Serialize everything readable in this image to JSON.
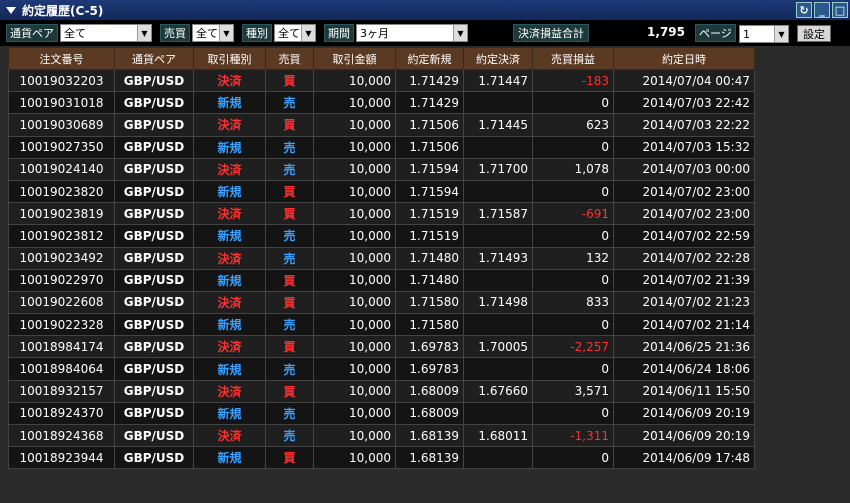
{
  "window": {
    "title": "約定履歴(C-5)",
    "buttons": [
      "refresh-icon",
      "minimize-icon",
      "maximize-icon"
    ]
  },
  "filters": {
    "pair_label": "通貨ペア",
    "pair_value": "全て",
    "side_label": "売買",
    "side_value": "全て",
    "type_label": "種別",
    "type_value": "全て",
    "period_label": "期間",
    "period_value": "3ヶ月",
    "total_label": "決済損益合計",
    "total_value": "1,795",
    "page_label": "ページ",
    "page_value": "1",
    "settings_label": "設定"
  },
  "table": {
    "headers": [
      "注文番号",
      "通貨ペア",
      "取引種別",
      "売買",
      "取引金額",
      "約定新規",
      "約定決済",
      "売買損益",
      "約定日時"
    ],
    "rows": [
      [
        "10019032203",
        "GBP/USD",
        "決済",
        "買",
        "10,000",
        "1.71429",
        "1.71447",
        "-183",
        "2014/07/04 00:47"
      ],
      [
        "10019031018",
        "GBP/USD",
        "新規",
        "売",
        "10,000",
        "1.71429",
        "",
        "0",
        "2014/07/03 22:42"
      ],
      [
        "10019030689",
        "GBP/USD",
        "決済",
        "買",
        "10,000",
        "1.71506",
        "1.71445",
        "623",
        "2014/07/03 22:22"
      ],
      [
        "10019027350",
        "GBP/USD",
        "新規",
        "売",
        "10,000",
        "1.71506",
        "",
        "0",
        "2014/07/03 15:32"
      ],
      [
        "10019024140",
        "GBP/USD",
        "決済",
        "売",
        "10,000",
        "1.71594",
        "1.71700",
        "1,078",
        "2014/07/03 00:00"
      ],
      [
        "10019023820",
        "GBP/USD",
        "新規",
        "買",
        "10,000",
        "1.71594",
        "",
        "0",
        "2014/07/02 23:00"
      ],
      [
        "10019023819",
        "GBP/USD",
        "決済",
        "買",
        "10,000",
        "1.71519",
        "1.71587",
        "-691",
        "2014/07/02 23:00"
      ],
      [
        "10019023812",
        "GBP/USD",
        "新規",
        "売",
        "10,000",
        "1.71519",
        "",
        "0",
        "2014/07/02 22:59"
      ],
      [
        "10019023492",
        "GBP/USD",
        "決済",
        "売",
        "10,000",
        "1.71480",
        "1.71493",
        "132",
        "2014/07/02 22:28"
      ],
      [
        "10019022970",
        "GBP/USD",
        "新規",
        "買",
        "10,000",
        "1.71480",
        "",
        "0",
        "2014/07/02 21:39"
      ],
      [
        "10019022608",
        "GBP/USD",
        "決済",
        "買",
        "10,000",
        "1.71580",
        "1.71498",
        "833",
        "2014/07/02 21:23"
      ],
      [
        "10019022328",
        "GBP/USD",
        "新規",
        "売",
        "10,000",
        "1.71580",
        "",
        "0",
        "2014/07/02 21:14"
      ],
      [
        "10018984174",
        "GBP/USD",
        "決済",
        "買",
        "10,000",
        "1.69783",
        "1.70005",
        "-2,257",
        "2014/06/25 21:36"
      ],
      [
        "10018984064",
        "GBP/USD",
        "新規",
        "売",
        "10,000",
        "1.69783",
        "",
        "0",
        "2014/06/24 18:06"
      ],
      [
        "10018932157",
        "GBP/USD",
        "決済",
        "買",
        "10,000",
        "1.68009",
        "1.67660",
        "3,571",
        "2014/06/11 15:50"
      ],
      [
        "10018924370",
        "GBP/USD",
        "新規",
        "売",
        "10,000",
        "1.68009",
        "",
        "0",
        "2014/06/09 20:19"
      ],
      [
        "10018924368",
        "GBP/USD",
        "決済",
        "売",
        "10,000",
        "1.68139",
        "1.68011",
        "-1,311",
        "2014/06/09 20:19"
      ],
      [
        "10018923944",
        "GBP/USD",
        "新規",
        "買",
        "10,000",
        "1.68139",
        "",
        "0",
        "2014/06/09 17:48"
      ]
    ]
  },
  "colors": {
    "settle": "#ff3030",
    "new": "#3aa0ff",
    "buy": "#ff3030",
    "sell": "#3aa0ff",
    "header_bg": "#5a3a22"
  }
}
